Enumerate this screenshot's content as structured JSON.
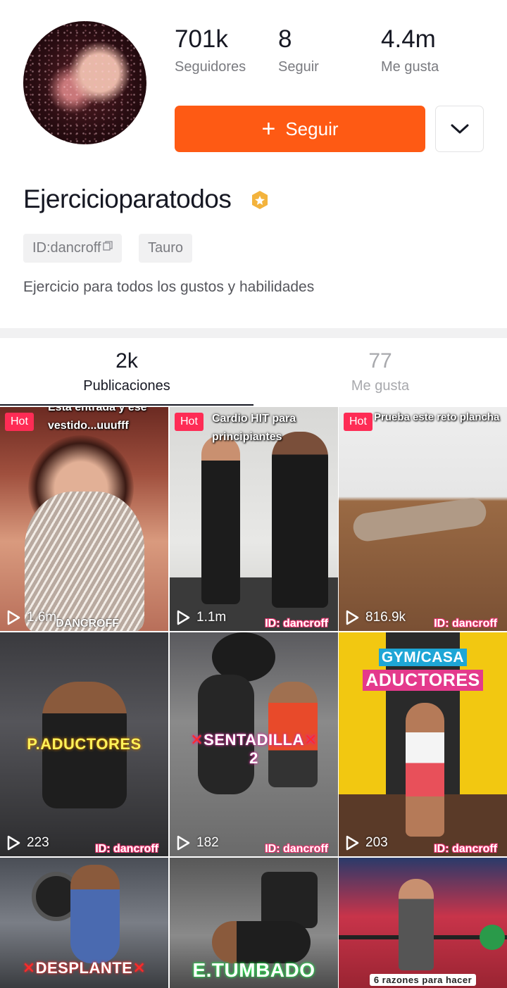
{
  "profile": {
    "name": "Ejercicioparatodos",
    "id_tag": "ID:dancroff",
    "zodiac_tag": "Tauro",
    "bio": "Ejercicio para todos los gustos y habilidades",
    "follow_label": "Seguir"
  },
  "stats": [
    {
      "value": "701k",
      "label": "Seguidores"
    },
    {
      "value": "8",
      "label": "Seguir"
    },
    {
      "value": "4.4m",
      "label": "Me gusta"
    }
  ],
  "tabs": [
    {
      "count": "2k",
      "label": "Publicaciones",
      "active": true
    },
    {
      "count": "77",
      "label": "Me gusta",
      "active": false
    }
  ],
  "videos": [
    {
      "hot": "Hot",
      "caption": [
        "Esta entrada y ese",
        "vestido...uuufff"
      ],
      "plays": "1.6m",
      "watermark": "DANCROFF",
      "overlay": ""
    },
    {
      "hot": "Hot",
      "caption": [
        "Cardio HIT para",
        "principiantes"
      ],
      "plays": "1.1m",
      "watermark": "ID: dancroff",
      "overlay": ""
    },
    {
      "hot": "Hot",
      "caption": [
        "Prueba este reto plancha"
      ],
      "plays": "816.9k",
      "watermark": "ID: dancroff",
      "overlay": ""
    },
    {
      "hot": "",
      "caption": [],
      "plays": "223",
      "watermark": "ID: dancroff",
      "overlay": "P.ADUCTORES"
    },
    {
      "hot": "",
      "caption": [],
      "plays": "182",
      "watermark": "ID: dancroff",
      "overlay": "SENTADILLA",
      "overlay2": "2"
    },
    {
      "hot": "",
      "caption": [],
      "plays": "203",
      "watermark": "ID: dancroff",
      "overlay": "ADUCTORES",
      "overlay_top": "GYM/CASA"
    },
    {
      "hot": "",
      "caption": [],
      "plays": "",
      "watermark": "",
      "overlay": "DESPLANTE"
    },
    {
      "hot": "",
      "caption": [],
      "plays": "",
      "watermark": "",
      "overlay": "E.TUMBADO"
    },
    {
      "hot": "",
      "caption": [],
      "plays": "",
      "watermark": "",
      "overlay": "6 razones para hacer"
    }
  ],
  "colors": {
    "accent": "#fe5a14",
    "hot": "#fe2c55"
  }
}
